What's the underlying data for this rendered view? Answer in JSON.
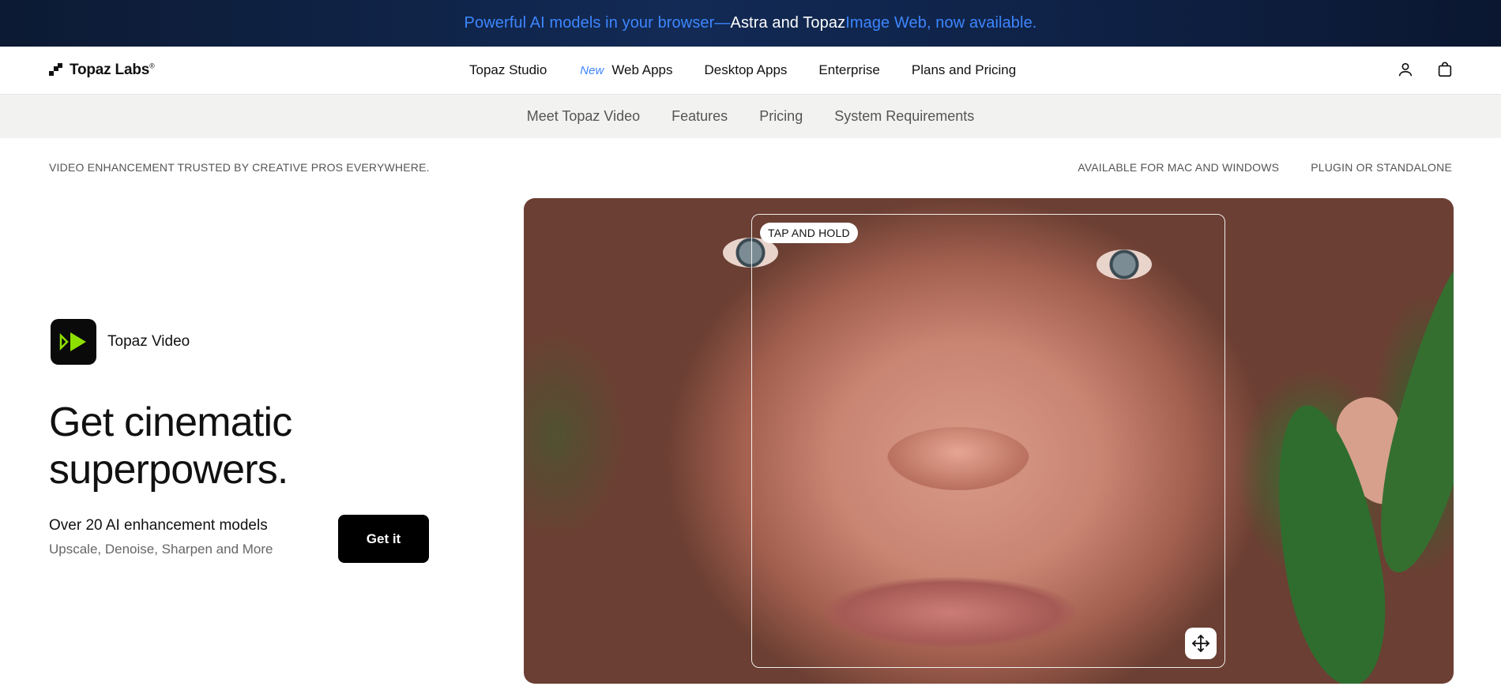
{
  "announcement": {
    "part1": "Powerful AI models in your browser",
    "part2": "—",
    "part3": "Astra and Topaz",
    "part4": " Image Web, now available."
  },
  "logo": {
    "text": "Topaz Labs",
    "mark": "®"
  },
  "nav": {
    "links": [
      "Topaz Studio",
      "Web Apps",
      "Desktop Apps",
      "Enterprise",
      "Plans and Pricing"
    ],
    "new_tag": "New",
    "icons": [
      "user-icon",
      "shopping-bag-icon"
    ]
  },
  "subnav": [
    "Meet Topaz Video",
    "Features",
    "Pricing",
    "System Requirements"
  ],
  "info": {
    "left": "VIDEO ENHANCEMENT TRUSTED BY CREATIVE PROS EVERYWHERE.",
    "right": [
      "AVAILABLE FOR MAC AND WINDOWS",
      "PLUGIN OR STANDALONE"
    ]
  },
  "hero": {
    "app_name": "Topaz Video",
    "headline_line1": "Get cinematic",
    "headline_line2": "superpowers.",
    "subtitle": "Over 20 AI enhancement models",
    "description": "Upscale, Denoise, Sharpen and More",
    "cta": "Get it",
    "compare_label": "TAP AND HOLD"
  },
  "colors": {
    "accent_blue": "#3d86ff",
    "app_icon_green": "#8ee000",
    "announce_bg": "#0f2247"
  }
}
